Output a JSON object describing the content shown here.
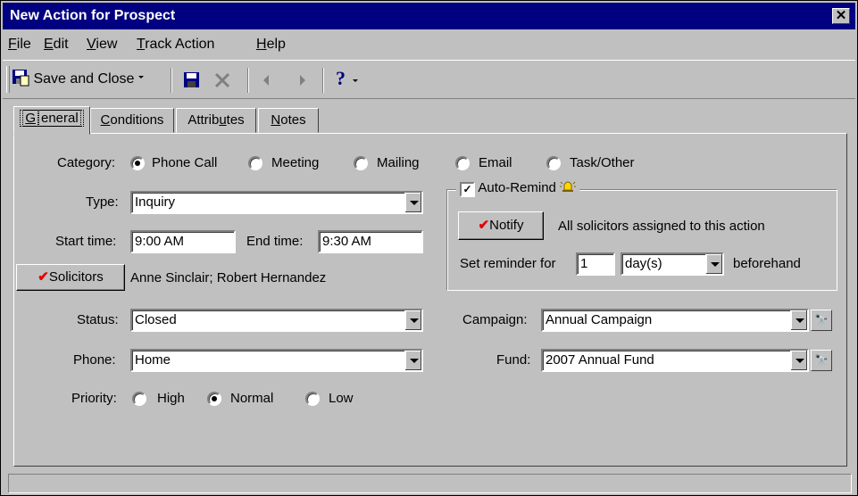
{
  "window": {
    "title": "New Action for Prospect",
    "close_glyph": "✕"
  },
  "menu": [
    {
      "key": "F",
      "rest": "ile"
    },
    {
      "key": "E",
      "rest": "dit"
    },
    {
      "key": "V",
      "rest": "iew"
    },
    {
      "key": "T",
      "rest": "rack Action"
    },
    {
      "key": "H",
      "rest": "elp"
    }
  ],
  "toolbar": {
    "save_close_label": "Save and Close",
    "icons": [
      "save-close-icon",
      "dropdown-arrow-icon",
      "save-icon",
      "delete-icon",
      "prev-icon",
      "next-icon",
      "help-icon"
    ]
  },
  "tabs": [
    {
      "key": "G",
      "rest": "eneral",
      "active": true
    },
    {
      "key": "C",
      "rest": "onditions",
      "active": false
    },
    {
      "pre": "Attrib",
      "key": "u",
      "rest": "tes",
      "active": false
    },
    {
      "key": "N",
      "rest": "otes",
      "active": false
    }
  ],
  "general": {
    "category_label": "Category:",
    "categories": [
      "Phone Call",
      "Meeting",
      "Mailing",
      "Email",
      "Task/Other"
    ],
    "category_selected": "Phone Call",
    "type_label": "Type:",
    "type_value": "Inquiry",
    "start_time_label": "Start time:",
    "start_time_value": "9:00 AM",
    "end_time_label": "End time:",
    "end_time_value": "9:30 AM",
    "solicitors_button": "Solicitors",
    "solicitors_value": "Anne Sinclair; Robert Hernandez",
    "status_label": "Status:",
    "status_value": "Closed",
    "phone_label": "Phone:",
    "phone_value": "Home",
    "priority_label": "Priority:",
    "priorities": [
      "High",
      "Normal",
      "Low"
    ],
    "priority_selected": "Normal"
  },
  "auto_remind": {
    "label": "Auto-Remind",
    "checked": true,
    "check_glyph": "✓",
    "notify_button": "Notify",
    "notify_text": "All solicitors assigned to this action",
    "set_reminder_label": "Set reminder for",
    "reminder_value": "1",
    "reminder_unit": "day(s)",
    "beforehand_label": "beforehand"
  },
  "campaign": {
    "campaign_label": "Campaign:",
    "campaign_value": "Annual Campaign",
    "fund_label": "Fund:",
    "fund_value": "2007 Annual Fund"
  },
  "colors": {
    "title_bar": "#000080",
    "window_face": "#c0c0c0",
    "checkmark": "#e00000"
  }
}
